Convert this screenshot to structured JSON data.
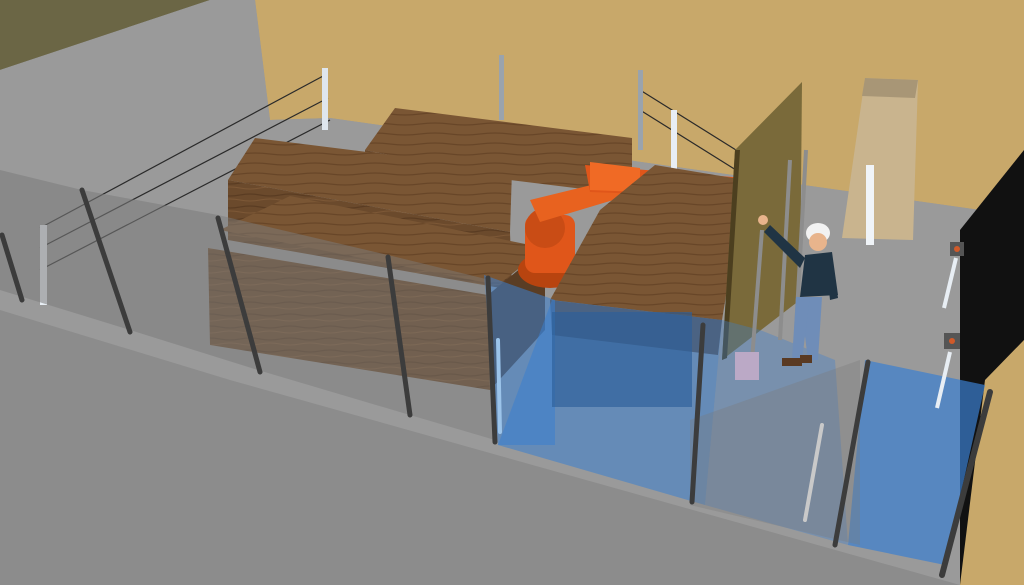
{
  "scene": {
    "colors": {
      "wall": "#c8a86a",
      "floor": "#979797",
      "floor_dark": "#7e7e7e",
      "wood": "#6b4a2c",
      "wood_top": "#7a5634",
      "robot": "#e0561a",
      "safety_zone": "#3a7fd0",
      "fence_post": "#3c3c3c"
    },
    "objects": {
      "robot": "industrial-robot-arm",
      "worker": "human-operator",
      "panel": "wooden-panel",
      "cabinet": "control-cabinet",
      "sensors": "light-curtain-sensor"
    }
  }
}
